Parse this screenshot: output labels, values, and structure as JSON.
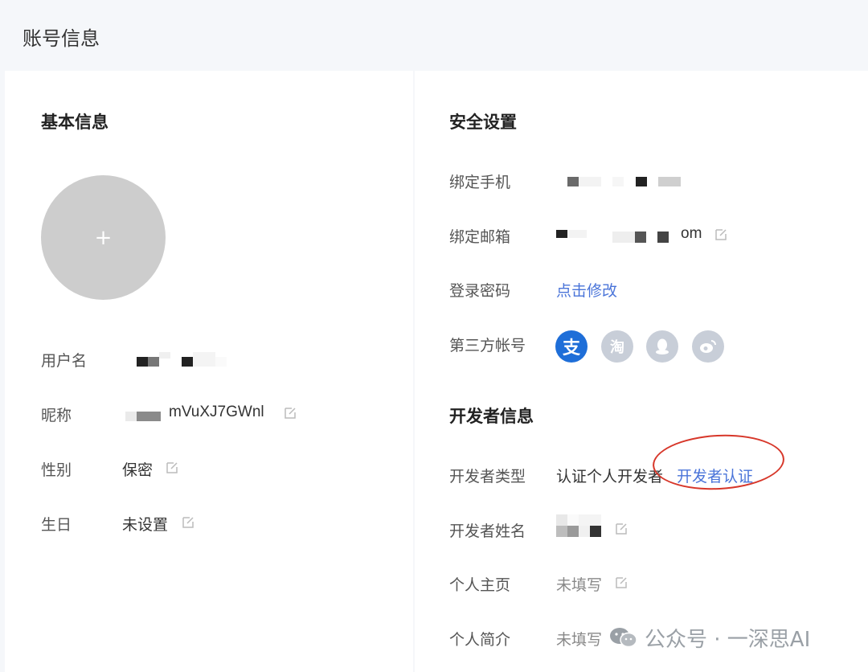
{
  "header": {
    "title": "账号信息"
  },
  "basic": {
    "title": "基本信息",
    "avatar_plus": "+",
    "username_label": "用户名",
    "nickname_label": "昵称",
    "nickname_value": "mVuXJ7GWnl",
    "gender_label": "性别",
    "gender_value": "保密",
    "birthday_label": "生日",
    "birthday_value": "未设置"
  },
  "security": {
    "title": "安全设置",
    "phone_label": "绑定手机",
    "email_label": "绑定邮箱",
    "email_suffix": "om",
    "password_label": "登录密码",
    "password_link": "点击修改",
    "third_party_label": "第三方帐号",
    "icons": [
      "alipay-icon",
      "taobao-icon",
      "qq-icon",
      "weibo-icon"
    ],
    "alipay_glyph": "支",
    "taobao_glyph": "淘"
  },
  "developer": {
    "title": "开发者信息",
    "type_label": "开发者类型",
    "type_value": "认证个人开发者",
    "certify_link": "开发者认证",
    "name_label": "开发者姓名",
    "homepage_label": "个人主页",
    "homepage_value": "未填写",
    "bio_label": "个人简介",
    "bio_value": "未填写"
  },
  "watermark": {
    "text": "公众号 · 一深思AI"
  },
  "colors": {
    "link": "#4a74d9",
    "alipay": "#1e6ed8",
    "icon_grey": "#c8ced8",
    "annotation": "#d7372a"
  }
}
